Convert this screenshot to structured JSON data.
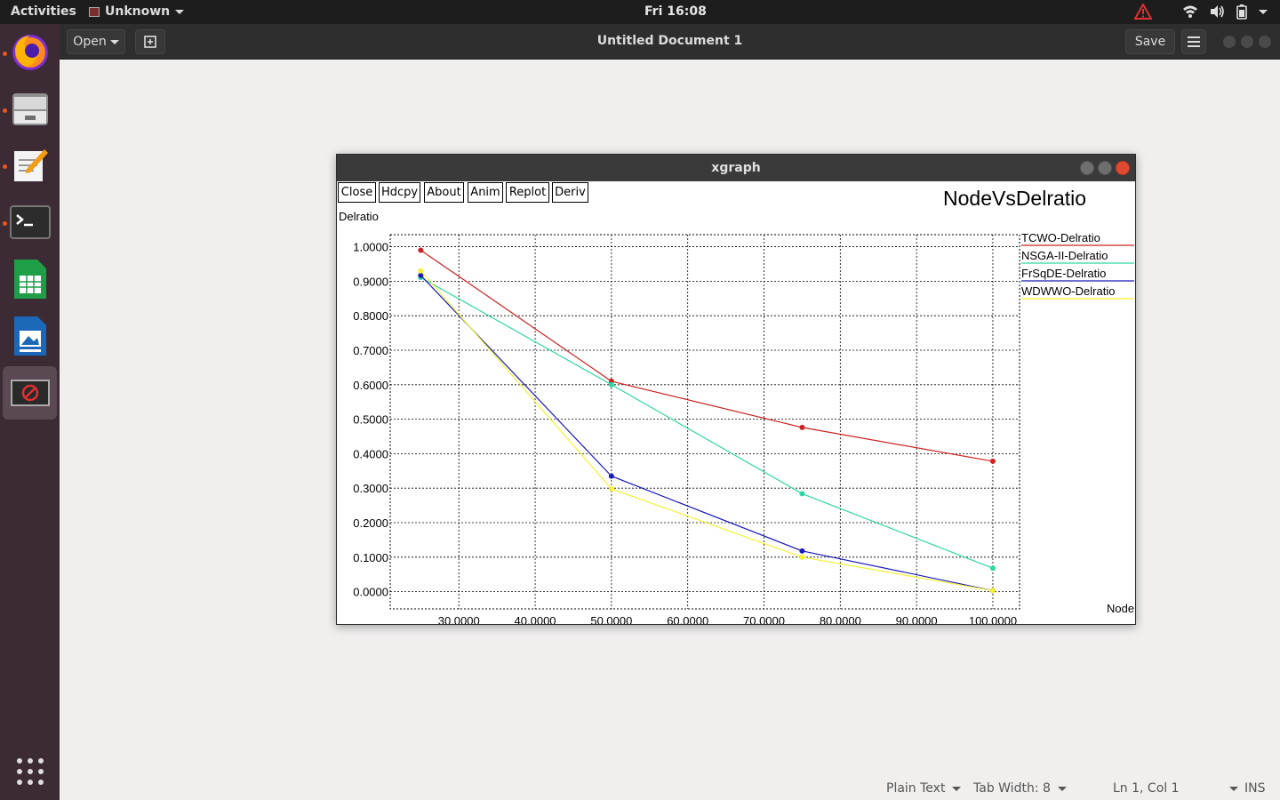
{
  "topbar": {
    "activities": "Activities",
    "app_menu": "Unknown",
    "clock": "Fri 16:08"
  },
  "dock": {
    "items": [
      "firefox",
      "files",
      "text-editor",
      "terminal",
      "spreadsheet",
      "presentation",
      "xgraph"
    ],
    "apps_grid": "show-applications"
  },
  "gedit": {
    "open_label": "Open",
    "title": "Untitled Document 1",
    "save_label": "Save"
  },
  "statusbar": {
    "language": "Plain Text",
    "tab_width": "Tab Width: 8",
    "position": "Ln 1, Col 1",
    "mode": "INS"
  },
  "xgraph": {
    "window_title": "xgraph",
    "buttons": [
      "Close",
      "Hdcpy",
      "About",
      "Anim",
      "Replot",
      "Deriv"
    ],
    "y_unit_label": "Delratio",
    "x_unit_label": "Node"
  },
  "chart_data": {
    "type": "line",
    "title": "NodeVsDelratio",
    "xlabel": "Node",
    "ylabel": "Delratio",
    "xlim": [
      21.0,
      103.5
    ],
    "ylim": [
      -0.05,
      1.035
    ],
    "x_ticks": [
      "30.0000",
      "40.0000",
      "50.0000",
      "60.0000",
      "70.0000",
      "80.0000",
      "90.0000",
      "100.0000"
    ],
    "x_tick_values": [
      30,
      40,
      50,
      60,
      70,
      80,
      90,
      100
    ],
    "y_ticks": [
      "0.0000",
      "0.1000",
      "0.2000",
      "0.3000",
      "0.4000",
      "0.5000",
      "0.6000",
      "0.7000",
      "0.8000",
      "0.9000",
      "1.0000"
    ],
    "y_tick_values": [
      0,
      0.1,
      0.2,
      0.3,
      0.4,
      0.5,
      0.6,
      0.7,
      0.8,
      0.9,
      1.0
    ],
    "grid": true,
    "legend_position": "right",
    "x": [
      25,
      50,
      75,
      100
    ],
    "series": [
      {
        "name": "TCWO-Delratio",
        "color": "#cc2222",
        "values": [
          0.99,
          0.61,
          0.476,
          0.378
        ]
      },
      {
        "name": "NSGA-II-Delratio",
        "color": "#2ed6a2",
        "values": [
          0.911,
          0.6,
          0.284,
          0.068
        ]
      },
      {
        "name": "FrSqDE-Delratio",
        "color": "#1a1ab8",
        "values": [
          0.917,
          0.335,
          0.118,
          0.003
        ]
      },
      {
        "name": "WDWWO-Delratio",
        "color": "#f2f232",
        "values": [
          0.93,
          0.298,
          0.1,
          0.003
        ]
      }
    ]
  }
}
